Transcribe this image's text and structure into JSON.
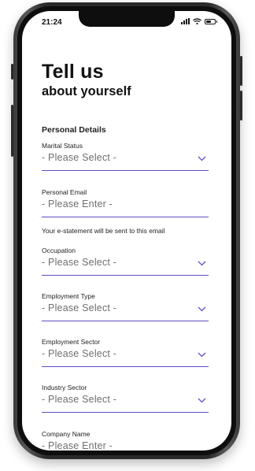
{
  "status": {
    "time": "21:24",
    "battery_level": 0.6
  },
  "heading": {
    "line1": "Tell us",
    "line2": "about yourself"
  },
  "section": {
    "title": "Personal Details"
  },
  "fields": [
    {
      "label": "Marital Status",
      "value": "- Please Select -",
      "type": "select"
    },
    {
      "label": "Personal Email",
      "value": "- Please Enter -",
      "type": "input"
    },
    {
      "label": "Occupation",
      "value": "- Please Select -",
      "type": "select"
    },
    {
      "label": "Employment Type",
      "value": "- Please Select -",
      "type": "select"
    },
    {
      "label": "Employment Sector",
      "value": "- Please Select -",
      "type": "select"
    },
    {
      "label": "Industry Sector",
      "value": "- Please Select -",
      "type": "select"
    },
    {
      "label": "Company Name",
      "value": "- Please Enter -",
      "type": "input"
    }
  ],
  "email_helper": "Your e-statement will be sent to this email",
  "colors": {
    "accent": "#5c4fc9",
    "text": "#111111",
    "placeholder": "#6f6f6f"
  }
}
